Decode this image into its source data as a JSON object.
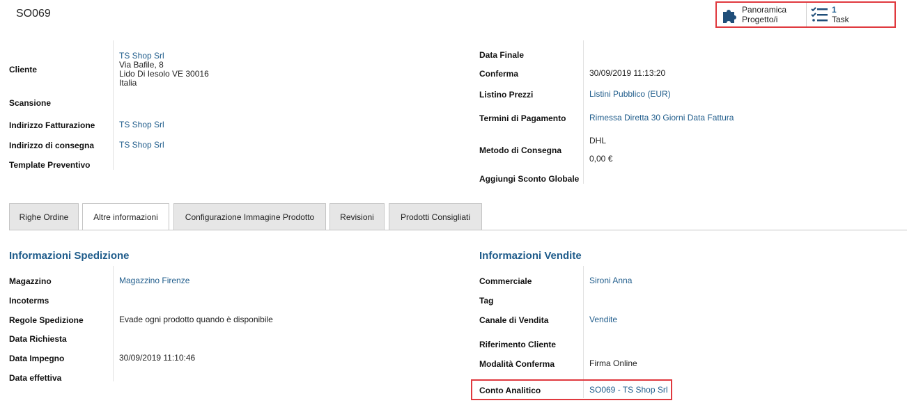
{
  "record_title": "SO069",
  "smart_buttons": {
    "overview_label_line1": "Panoramica",
    "overview_label_line2": "Progetto/i",
    "task_count": "1",
    "task_label": "Task"
  },
  "header_left": {
    "cliente_label": "Cliente",
    "cliente_name": "TS Shop Srl",
    "cliente_addr1": "Via Bafile, 8",
    "cliente_addr2": "Lido Di Iesolo VE 30016",
    "cliente_addr3": "Italia",
    "scansione_label": "Scansione",
    "fatturazione_label": "Indirizzo Fatturazione",
    "fatturazione_value": "TS Shop Srl",
    "consegna_label": "Indirizzo di consegna",
    "consegna_value": "TS Shop Srl",
    "template_label": "Template Preventivo"
  },
  "header_right": {
    "data_finale_label": "Data Finale",
    "conferma_label": "Conferma",
    "conferma_value": "30/09/2019 11:13:20",
    "listino_label": "Listino Prezzi",
    "listino_value": "Listini Pubblico (EUR)",
    "termini_label": "Termini di Pagamento",
    "termini_value": "Rimessa Diretta 30 Giorni Data Fattura",
    "metodo_label": "Metodo di Consegna",
    "metodo_value": "DHL",
    "metodo_amount": "0,00 €",
    "sconto_label": "Aggiungi Sconto Globale"
  },
  "tabs": [
    {
      "label": "Righe Ordine"
    },
    {
      "label": "Altre informazioni"
    },
    {
      "label": "Configurazione Immagine Prodotto"
    },
    {
      "label": "Revisioni"
    },
    {
      "label": "Prodotti Consigliati"
    }
  ],
  "shipping": {
    "title": "Informazioni Spedizione",
    "magazzino_label": "Magazzino",
    "magazzino_value": "Magazzino Firenze",
    "incoterms_label": "Incoterms",
    "regole_label": "Regole Spedizione",
    "regole_value": "Evade ogni prodotto quando è disponibile",
    "richiesta_label": "Data Richiesta",
    "impegno_label": "Data Impegno",
    "impegno_value": "30/09/2019 11:10:46",
    "effettiva_label": "Data effettiva"
  },
  "sales": {
    "title": "Informazioni Vendite",
    "commerciale_label": "Commerciale",
    "commerciale_value": "Sironi Anna",
    "tag_label": "Tag",
    "canale_label": "Canale di Vendita",
    "canale_value": "Vendite",
    "riferimento_label": "Riferimento Cliente",
    "modalita_label": "Modalità Conferma",
    "modalita_value": "Firma Online",
    "conto_label": "Conto Analitico",
    "conto_value": "SO069 - TS Shop Srl"
  },
  "colors": {
    "link": "#1f5c8b",
    "highlight": "#e0393e",
    "tab_inactive": "#e6e6e6"
  }
}
